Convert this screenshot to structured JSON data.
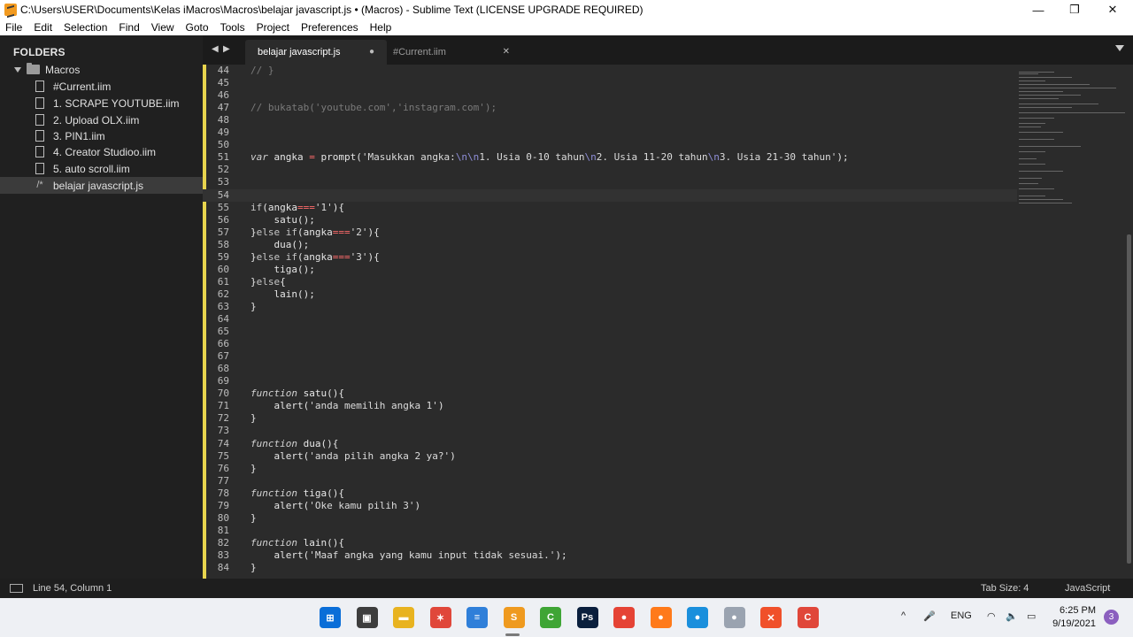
{
  "window": {
    "title": "C:\\Users\\USER\\Documents\\Kelas iMacros\\Macros\\belajar javascript.js • (Macros) - Sublime Text (LICENSE UPGRADE REQUIRED)",
    "minimize_glyph": "—",
    "maximize_glyph": "❐",
    "close_glyph": "✕"
  },
  "menu": [
    "File",
    "Edit",
    "Selection",
    "Find",
    "View",
    "Goto",
    "Tools",
    "Project",
    "Preferences",
    "Help"
  ],
  "sidebar": {
    "heading": "FOLDERS",
    "root": "Macros",
    "files": [
      {
        "name": "#Current.iim",
        "icon": "file-icon"
      },
      {
        "name": "1. SCRAPE YOUTUBE.iim",
        "icon": "file-icon"
      },
      {
        "name": "2. Upload OLX.iim",
        "icon": "file-icon"
      },
      {
        "name": "3. PIN1.iim",
        "icon": "file-icon"
      },
      {
        "name": "4. Creator Studioo.iim",
        "icon": "file-icon"
      },
      {
        "name": "5. auto scroll.iim",
        "icon": "file-icon"
      },
      {
        "name": "belajar javascript.js",
        "icon": "js-file-icon",
        "selected": true
      }
    ]
  },
  "tabs": {
    "left_arrow": "◀",
    "right_arrow": "▶",
    "items": [
      {
        "label": "belajar javascript.js",
        "state": "●",
        "active": true
      },
      {
        "label": "#Current.iim",
        "state": "✕",
        "active": false
      }
    ]
  },
  "editor": {
    "current_line": 54,
    "lines": [
      {
        "n": "44",
        "t": [
          [
            "c-com",
            "// }"
          ]
        ]
      },
      {
        "n": "45",
        "t": []
      },
      {
        "n": "46",
        "t": []
      },
      {
        "n": "47",
        "t": [
          [
            "c-com",
            "// bukatab('youtube.com','instagram.com');"
          ]
        ]
      },
      {
        "n": "48",
        "t": []
      },
      {
        "n": "49",
        "t": []
      },
      {
        "n": "50",
        "t": []
      },
      {
        "n": "51",
        "t": [
          [
            "c-kw",
            "var"
          ],
          [
            "",
            " angka "
          ],
          [
            "c-op",
            "="
          ],
          [
            "",
            " prompt("
          ],
          [
            "c-str",
            "'Masukkan angka:"
          ],
          [
            "c-esc",
            "\\n\\n"
          ],
          [
            "c-str",
            "1. Usia 0-10 tahun"
          ],
          [
            "c-esc",
            "\\n"
          ],
          [
            "c-str",
            "2. Usia 11-20 tahun"
          ],
          [
            "c-esc",
            "\\n"
          ],
          [
            "c-str",
            "3. Usia 21-30 tahun'"
          ],
          [
            "",
            ");"
          ]
        ]
      },
      {
        "n": "52",
        "t": []
      },
      {
        "n": "53",
        "t": []
      },
      {
        "n": "54",
        "t": []
      },
      {
        "n": "55",
        "t": [
          [
            "c-kw2",
            "if"
          ],
          [
            "",
            "(angka"
          ],
          [
            "c-op",
            "==="
          ],
          [
            "c-str",
            "'1'"
          ],
          [
            "",
            "){"
          ]
        ]
      },
      {
        "n": "56",
        "t": [
          [
            "",
            "    satu();"
          ]
        ]
      },
      {
        "n": "57",
        "t": [
          [
            "",
            "}"
          ],
          [
            "c-kw2",
            "else if"
          ],
          [
            "",
            "(angka"
          ],
          [
            "c-op",
            "==="
          ],
          [
            "c-str",
            "'2'"
          ],
          [
            "",
            "){"
          ]
        ]
      },
      {
        "n": "58",
        "t": [
          [
            "",
            "    dua();"
          ]
        ]
      },
      {
        "n": "59",
        "t": [
          [
            "",
            "}"
          ],
          [
            "c-kw2",
            "else if"
          ],
          [
            "",
            "(angka"
          ],
          [
            "c-op",
            "==="
          ],
          [
            "c-str",
            "'3'"
          ],
          [
            "",
            "){"
          ]
        ]
      },
      {
        "n": "60",
        "t": [
          [
            "",
            "    tiga();"
          ]
        ]
      },
      {
        "n": "61",
        "t": [
          [
            "",
            "}"
          ],
          [
            "c-kw2",
            "else"
          ],
          [
            "",
            "{"
          ]
        ]
      },
      {
        "n": "62",
        "t": [
          [
            "",
            "    lain();"
          ]
        ]
      },
      {
        "n": "63",
        "t": [
          [
            "",
            "}"
          ]
        ]
      },
      {
        "n": "64",
        "t": []
      },
      {
        "n": "65",
        "t": []
      },
      {
        "n": "66",
        "t": []
      },
      {
        "n": "67",
        "t": []
      },
      {
        "n": "68",
        "t": []
      },
      {
        "n": "69",
        "t": []
      },
      {
        "n": "70",
        "t": [
          [
            "c-kw",
            "function"
          ],
          [
            "",
            " "
          ],
          [
            "c-fn",
            "satu"
          ],
          [
            "",
            "(){"
          ]
        ]
      },
      {
        "n": "71",
        "t": [
          [
            "",
            "    alert("
          ],
          [
            "c-str",
            "'anda memilih angka 1'"
          ],
          [
            "",
            ")"
          ]
        ]
      },
      {
        "n": "72",
        "t": [
          [
            "",
            "}"
          ]
        ]
      },
      {
        "n": "73",
        "t": []
      },
      {
        "n": "74",
        "t": [
          [
            "c-kw",
            "function"
          ],
          [
            "",
            " "
          ],
          [
            "c-fn",
            "dua"
          ],
          [
            "",
            "(){"
          ]
        ]
      },
      {
        "n": "75",
        "t": [
          [
            "",
            "    alert("
          ],
          [
            "c-str",
            "'anda pilih angka 2 ya?'"
          ],
          [
            "",
            ")"
          ]
        ]
      },
      {
        "n": "76",
        "t": [
          [
            "",
            "}"
          ]
        ]
      },
      {
        "n": "77",
        "t": []
      },
      {
        "n": "78",
        "t": [
          [
            "c-kw",
            "function"
          ],
          [
            "",
            " "
          ],
          [
            "c-fn",
            "tiga"
          ],
          [
            "",
            "(){"
          ]
        ]
      },
      {
        "n": "79",
        "t": [
          [
            "",
            "    alert("
          ],
          [
            "c-str",
            "'Oke kamu pilih 3'"
          ],
          [
            "",
            ")"
          ]
        ]
      },
      {
        "n": "80",
        "t": [
          [
            "",
            "}"
          ]
        ]
      },
      {
        "n": "81",
        "t": []
      },
      {
        "n": "82",
        "t": [
          [
            "c-kw",
            "function"
          ],
          [
            "",
            " "
          ],
          [
            "c-fn",
            "lain"
          ],
          [
            "",
            "(){"
          ]
        ]
      },
      {
        "n": "83",
        "t": [
          [
            "",
            "    alert("
          ],
          [
            "c-str",
            "'Maaf angka yang kamu input tidak sesuai.'"
          ],
          [
            "",
            ");"
          ]
        ]
      },
      {
        "n": "84",
        "t": [
          [
            "",
            "}"
          ]
        ]
      }
    ]
  },
  "status": {
    "cursor": "Line 54, Column 1",
    "tab_size": "Tab Size: 4",
    "syntax": "JavaScript"
  },
  "taskbar": {
    "apps": [
      {
        "name": "start-icon",
        "glyph": "⊞",
        "color": "#0a6ed8"
      },
      {
        "name": "task-view-icon",
        "glyph": "▣",
        "color": "#3d3d3d"
      },
      {
        "name": "file-explorer-icon",
        "glyph": "▬",
        "color": "#e8b320"
      },
      {
        "name": "app-icon",
        "glyph": "✶",
        "color": "#e0473a"
      },
      {
        "name": "notepad-icon",
        "glyph": "≡",
        "color": "#2f7fd9"
      },
      {
        "name": "sublime-text-icon",
        "glyph": "S",
        "color": "#ef9a1f"
      },
      {
        "name": "camtasia-icon",
        "glyph": "C",
        "color": "#3fa535"
      },
      {
        "name": "photoshop-icon",
        "glyph": "Ps",
        "color": "#0a1f3d"
      },
      {
        "name": "chrome-icon",
        "glyph": "●",
        "color": "#e54335"
      },
      {
        "name": "firefox-icon",
        "glyph": "●",
        "color": "#ff7a1a"
      },
      {
        "name": "edge-icon",
        "glyph": "●",
        "color": "#1a8fdc"
      },
      {
        "name": "app-circle-icon",
        "glyph": "●",
        "color": "#9aa3b0"
      },
      {
        "name": "xampp-icon",
        "glyph": "✕",
        "color": "#f0502a"
      },
      {
        "name": "camtasia-recorder-icon",
        "glyph": "C",
        "color": "#e0473a"
      }
    ],
    "tray": {
      "chevron": "^",
      "mic": "🎤",
      "lang": "ENG",
      "wifi": "◠",
      "volume": "🔈",
      "battery": "▭",
      "time": "6:25 PM",
      "date": "9/19/2021",
      "notifications": "3"
    }
  }
}
